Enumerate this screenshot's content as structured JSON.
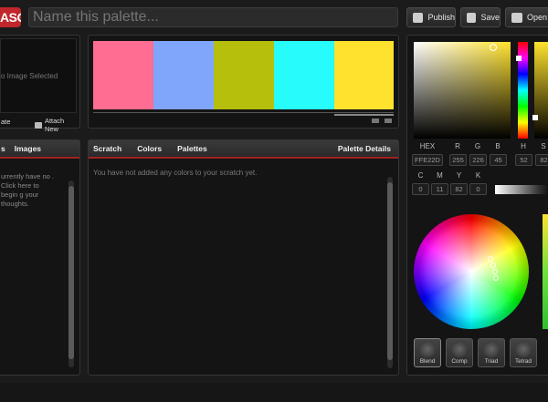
{
  "app": {
    "logo": "ASO"
  },
  "toolbar": {
    "name_placeholder": "Name this palette...",
    "publish_label": "Publish",
    "save_label": "Save",
    "open_label": "Open"
  },
  "image_panel": {
    "empty_text": "o Image Selected",
    "update_label": "ate",
    "attach_label": "Attach New"
  },
  "palette": {
    "colors": [
      "#ff6d92",
      "#7fa6fb",
      "#b6bf0b",
      "#27fbfb",
      "#ffe22d"
    ]
  },
  "notes_panel": {
    "tabs": [
      "s",
      "Images"
    ],
    "text": "urrently have no . Click here to begin g your thoughts."
  },
  "scratch_panel": {
    "tabs": [
      "Scratch",
      "Colors",
      "Palettes"
    ],
    "active_tab": "Scratch",
    "details_label": "Palette Details",
    "empty_text": "You have not added any colors to your scratch yet."
  },
  "color_panel": {
    "labels": {
      "hex": "HEX",
      "r": "R",
      "g": "G",
      "b": "B",
      "h": "H",
      "s": "S",
      "c": "C",
      "m": "M",
      "y": "Y",
      "k": "K"
    },
    "values": {
      "hex": "FFE22D",
      "r": "255",
      "g": "226",
      "b": "45",
      "h": "52",
      "s": "82",
      "c": "0",
      "m": "11",
      "y": "82",
      "k": "0"
    },
    "harmony": [
      "Blend",
      "Comp",
      "Triad",
      "Tetrad"
    ],
    "harmony_active": "Blend"
  }
}
